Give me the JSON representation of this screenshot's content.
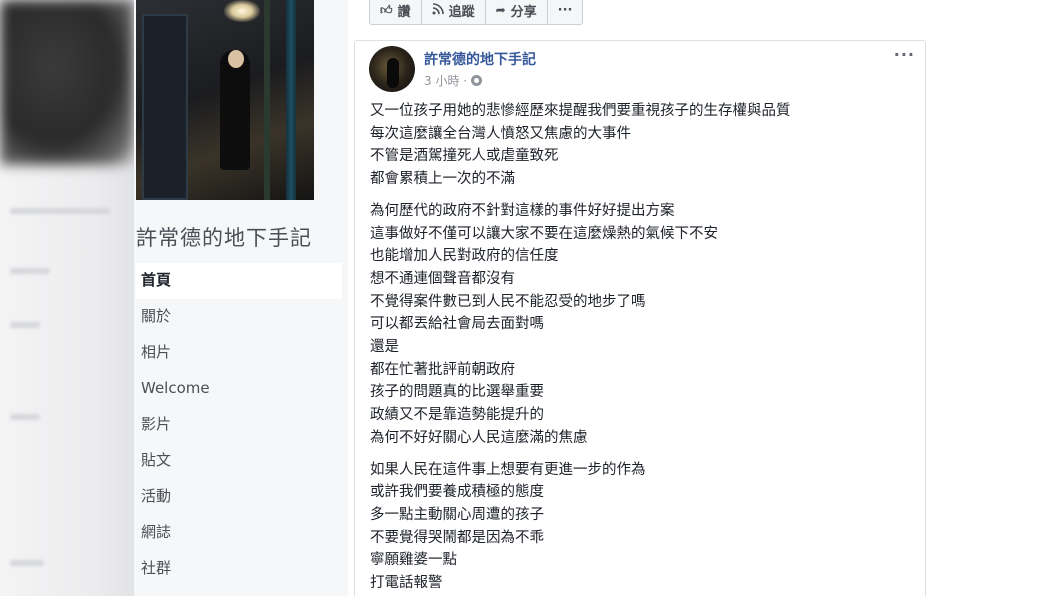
{
  "page": {
    "name": "許常德的地下手記",
    "nav": [
      {
        "label": "首頁",
        "active": true
      },
      {
        "label": "關於"
      },
      {
        "label": "相片"
      },
      {
        "label": "Welcome"
      },
      {
        "label": "影片"
      },
      {
        "label": "貼文"
      },
      {
        "label": "活動"
      },
      {
        "label": "網誌"
      },
      {
        "label": "社群"
      }
    ]
  },
  "actions": {
    "like": {
      "label": "讚",
      "icon": "thumbs-up-icon"
    },
    "follow": {
      "label": "追蹤",
      "icon": "rss-icon"
    },
    "share": {
      "label": "分享",
      "icon": "share-arrow-icon"
    },
    "more": "···"
  },
  "post": {
    "author": "許常德的地下手記",
    "time": "3 小時 ·",
    "privacy_icon": "globe-icon",
    "more": "···",
    "paragraphs": [
      [
        "又一位孩子用她的悲慘經歷來提醒我們要重視孩子的生存權與品質",
        "每次這麼讓全台灣人憤怒又焦慮的大事件",
        "不管是酒駕撞死人或虐童致死",
        "都會累積上一次的不滿"
      ],
      [
        "為何歷代的政府不針對這樣的事件好好提出方案",
        "這事做好不僅可以讓大家不要在這麼燥熱的氣候下不安",
        "也能增加人民對政府的信任度",
        "想不通連個聲音都沒有",
        "不覺得案件數已到人民不能忍受的地步了嗎",
        "可以都丟給社會局去面對嗎",
        "還是",
        "都在忙著批評前朝政府",
        "孩子的問題真的比選舉重要",
        "政績又不是靠造勢能提升的",
        "為何不好好關心人民這麼滿的焦慮"
      ],
      [
        "如果人民在這件事上想要有更進一步的作為",
        "或許我們要養成積極的態度",
        "多一點主動關心周遭的孩子",
        "不要覺得哭鬧都是因為不乖",
        "寧願雞婆一點",
        "打電話報警"
      ]
    ]
  },
  "colors": {
    "link": "#365899",
    "text": "#1d2129",
    "meta": "#90949c",
    "nav_bg": "#f6f7f9"
  }
}
